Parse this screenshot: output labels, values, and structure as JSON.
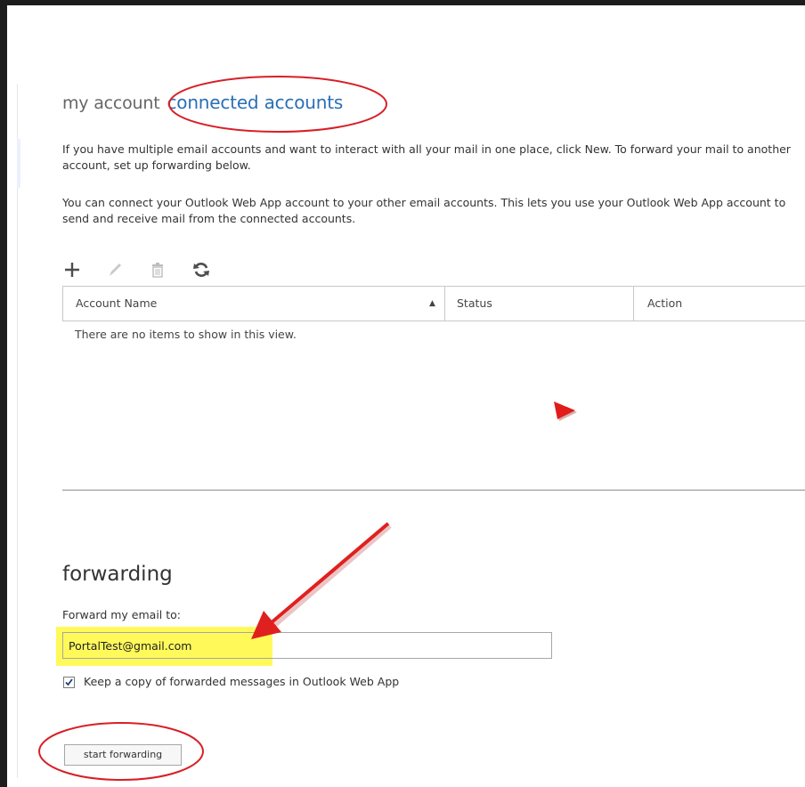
{
  "breadcrumb": {
    "parent": "my account",
    "current": "connected accounts"
  },
  "intro": {
    "paragraph1": "If you have multiple email accounts and want to interact with all your mail in one place, click New. To forward your mail to another account, set up forwarding below.",
    "paragraph2": "You can connect your Outlook Web App account to your other email accounts. This lets you use your Outlook Web App account to send and receive mail from the connected accounts."
  },
  "toolbar": {
    "icons": [
      "add-icon",
      "edit-icon",
      "delete-icon",
      "refresh-icon"
    ]
  },
  "grid": {
    "columns": [
      "Account Name",
      "Status",
      "Action"
    ],
    "sort_indicator": "▲",
    "empty_message": "There are no items to show in this view."
  },
  "forwarding": {
    "title": "forwarding",
    "field_label": "Forward my email to:",
    "email_value": "PortalTest@gmail.com",
    "keep_copy_label": "Keep a copy of forwarded messages in Outlook Web App",
    "keep_copy_checked": true,
    "button_label": "start forwarding"
  },
  "colors": {
    "accent": "#2a6fb6",
    "annotation_red": "#d81f26",
    "highlight_yellow": "#fff95a"
  }
}
